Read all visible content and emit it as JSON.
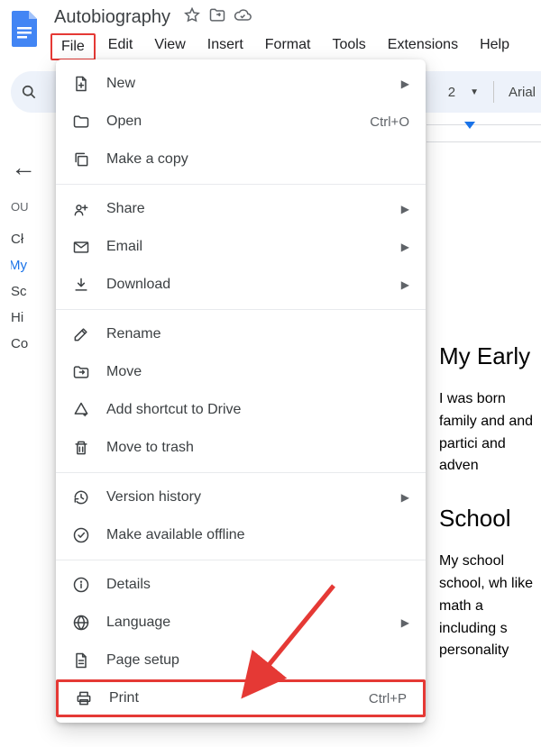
{
  "doc_title": "Autobiography",
  "menubar": {
    "file": "File",
    "edit": "Edit",
    "view": "View",
    "insert": "Insert",
    "format": "Format",
    "tools": "Tools",
    "extensions": "Extensions",
    "help": "Help"
  },
  "toolbar": {
    "zoom_frag": "2",
    "font": "Arial"
  },
  "outline": {
    "heading": "OU",
    "items": [
      "Cł",
      "My",
      "Sc",
      "Hi",
      "Co"
    ]
  },
  "document": {
    "h1": "My Early",
    "p1": "I was born family and and partici and adven",
    "h2": "School",
    "p2": "My school school, wh like math a including s personality"
  },
  "filemenu": {
    "new": "New",
    "open": "Open",
    "open_shortcut": "Ctrl+O",
    "makecopy": "Make a copy",
    "share": "Share",
    "email": "Email",
    "download": "Download",
    "rename": "Rename",
    "move": "Move",
    "addshortcut": "Add shortcut to Drive",
    "trash": "Move to trash",
    "version": "Version history",
    "offline": "Make available offline",
    "details": "Details",
    "language": "Language",
    "pagesetup": "Page setup",
    "print": "Print",
    "print_shortcut": "Ctrl+P"
  }
}
